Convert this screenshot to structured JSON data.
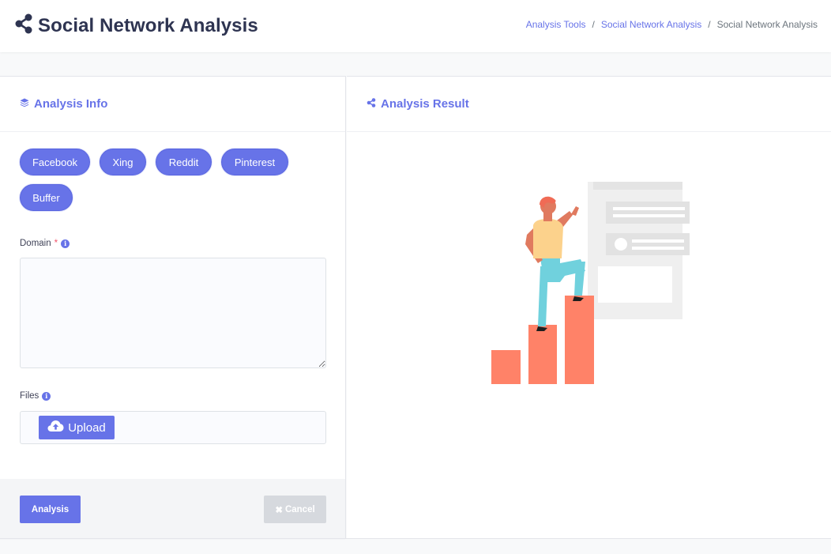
{
  "header": {
    "title": "Social Network Analysis",
    "icon": "share-icon",
    "breadcrumb": [
      "Analysis Tools",
      "Social Network Analysis",
      "Social Network Analysis"
    ]
  },
  "left_panel": {
    "title": "Analysis Info",
    "icon": "layers-icon",
    "chips": [
      "Facebook",
      "Xing",
      "Reddit",
      "Pinterest",
      "Buffer"
    ],
    "domain_label": "Domain",
    "domain_required": "*",
    "domain_value": "",
    "files_label": "Files",
    "upload_label": "Upload",
    "analysis_button": "Analysis",
    "cancel_button": "Cancel"
  },
  "right_panel": {
    "title": "Analysis Result",
    "icon": "share-icon"
  },
  "colors": {
    "accent": "#6773e8",
    "bars": "#ff8268",
    "title": "#2e3451"
  }
}
